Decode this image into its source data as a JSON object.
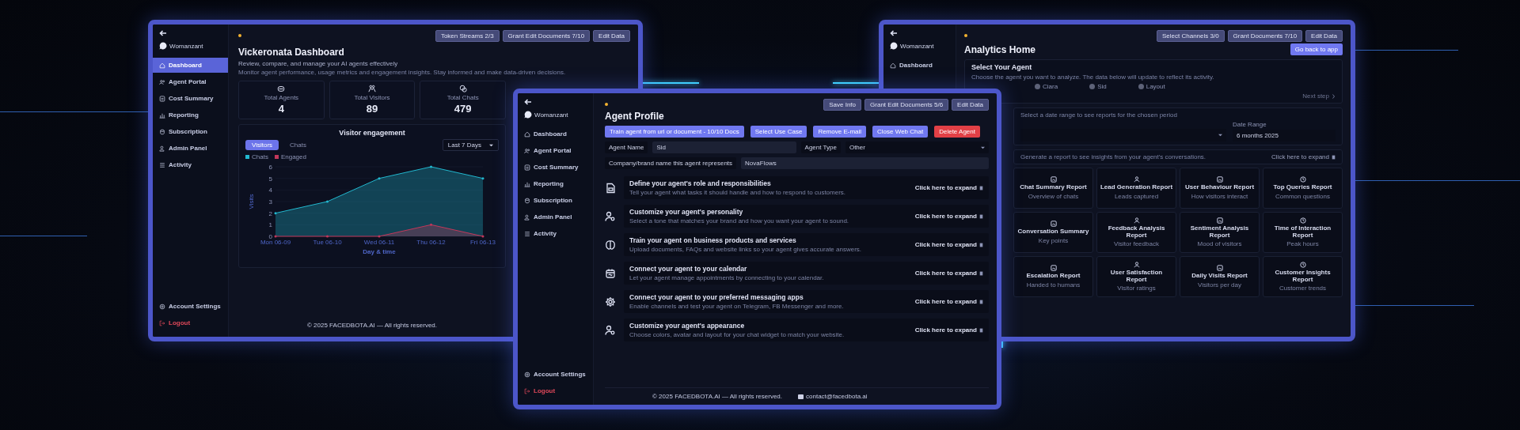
{
  "left_window": {
    "brand": "Womanzant",
    "nav": [
      {
        "label": "Dashboard",
        "selected": true
      },
      {
        "label": "Agent Portal",
        "selected": false
      },
      {
        "label": "Cost Summary",
        "selected": false
      },
      {
        "label": "Reporting",
        "selected": false
      },
      {
        "label": "Subscription",
        "selected": false
      },
      {
        "label": "Admin Panel",
        "selected": false
      },
      {
        "label": "Activity",
        "selected": false
      }
    ],
    "footer_nav": [
      {
        "label": "Account Settings",
        "kind": "normal"
      },
      {
        "label": "Logout",
        "kind": "danger"
      }
    ],
    "header_buttons": [
      "Token Streams 2/3",
      "Grant Edit Documents 7/10",
      "Edit Data"
    ],
    "title": "Vickeronata Dashboard",
    "subtitle": "Review, compare, and manage your AI agents effectively",
    "intro": "Monitor agent performance, usage metrics and engagement insights. Stay informed and make data-driven decisions.",
    "stats": [
      {
        "label": "Total Agents",
        "value": "4"
      },
      {
        "label": "Total Visitors",
        "value": "89"
      },
      {
        "label": "Total Chats",
        "value": "479"
      }
    ],
    "chart": {
      "tabs": [
        {
          "label": "Visitors",
          "selected": true
        },
        {
          "label": "Chats",
          "selected": false
        }
      ],
      "range": "Last 7 Days",
      "chart_data": {
        "type": "area",
        "title": "Visitor engagement",
        "xlabel": "Day & time",
        "ylabel": "Visits",
        "categories": [
          "Mon 06-09",
          "Tue 06-10",
          "Wed 06-11",
          "Thu 06-12",
          "Fri 06-13"
        ],
        "series": [
          {
            "name": "Chats",
            "color": "#22b8cf",
            "values": [
              2,
              3,
              5,
              6,
              5
            ]
          },
          {
            "name": "Engaged",
            "color": "#c2375a",
            "values": [
              0,
              0,
              0,
              1,
              0
            ]
          }
        ],
        "ylim": [
          0,
          6
        ],
        "yticks": [
          0,
          1,
          2,
          3,
          4,
          5,
          6
        ]
      }
    },
    "footer": "© 2025 FACEDBOTA.AI — All rights reserved."
  },
  "middle_window": {
    "brand": "Womanzant",
    "nav": [
      {
        "label": "Dashboard",
        "selected": false
      },
      {
        "label": "Agent Portal",
        "selected": false
      },
      {
        "label": "Cost Summary",
        "selected": false
      },
      {
        "label": "Reporting",
        "selected": false
      },
      {
        "label": "Subscription",
        "selected": false
      },
      {
        "label": "Admin Panel",
        "selected": false
      },
      {
        "label": "Activity",
        "selected": false
      }
    ],
    "footer_nav": [
      {
        "label": "Account Settings",
        "kind": "normal"
      },
      {
        "label": "Logout",
        "kind": "danger"
      }
    ],
    "header_buttons": [
      "Save Info",
      "Grant Edit Documents 5/6",
      "Edit Data"
    ],
    "title": "Agent Profile",
    "actions": [
      {
        "label": "Train agent from url or document - 10/10 Docs",
        "kind": "primary"
      },
      {
        "label": "Select Use Case",
        "kind": "primary"
      },
      {
        "label": "Remove E-mail",
        "kind": "primary"
      },
      {
        "label": "Close Web Chat",
        "kind": "primary"
      },
      {
        "label": "Delete Agent",
        "kind": "danger"
      }
    ],
    "fields": [
      {
        "label": "Agent Name",
        "value": "Sid",
        "kind": "text"
      },
      {
        "label": "Agent Type",
        "value": "Other",
        "kind": "select"
      },
      {
        "label": "Company/brand name this agent represents",
        "value": "NovaFlows",
        "kind": "text"
      }
    ],
    "tasks": [
      {
        "title": "Define your agent's role and responsibilities",
        "description": "Tell your agent what tasks it should handle and how to respond to customers.",
        "action": "Click here to expand"
      },
      {
        "title": "Customize your agent's personality",
        "description": "Select a tone that matches your brand and how you want your agent to sound.",
        "action": "Click here to expand"
      },
      {
        "title": "Train your agent on business products and services",
        "description": "Upload documents, FAQs and website links so your agent gives accurate answers.",
        "action": "Click here to expand"
      },
      {
        "title": "Connect your agent to your calendar",
        "description": "Let your agent manage appointments by connecting to your calendar.",
        "action": "Click here to expand"
      },
      {
        "title": "Connect your agent to your preferred messaging apps",
        "description": "Enable channels and test your agent on Telegram, FB Messenger and more.",
        "action": "Click here to expand"
      },
      {
        "title": "Customize your agent's appearance",
        "description": "Choose colors, avatar and layout for your chat widget to match your website.",
        "action": "Click here to expand"
      }
    ],
    "footer": "© 2025 FACEDBOTA.AI — All rights reserved.",
    "email": "contact@facedbota.ai"
  },
  "right_window": {
    "brand": "Womanzant",
    "nav": [
      {
        "label": "Dashboard",
        "selected": false
      }
    ],
    "header_buttons": [
      "Select Channels 3/0",
      "Grant Documents 7/10",
      "Edit Data"
    ],
    "back_button": "Go back to app",
    "title": "Analytics Home",
    "agent_card": {
      "title": "Select Your Agent",
      "description": "Choose the agent you want to analyze. The data below will update to reflect its activity.",
      "options": [
        {
          "label": "Ciara",
          "selected": false
        },
        {
          "label": "Sid",
          "selected": false
        },
        {
          "label": "Layout",
          "selected": false
        }
      ],
      "next": "Next step"
    },
    "filter": {
      "text": "Select a date range to see reports for the chosen period",
      "date_label": "Date Range",
      "date_value": "6 months 2025"
    },
    "report_bar": {
      "text": "Generate a report to see insights from your agent's conversations.",
      "action": "Click here to expand"
    },
    "reports": [
      {
        "title": "Chat Summary Report",
        "description": "Overview of chats"
      },
      {
        "title": "Lead Generation Report",
        "description": "Leads captured"
      },
      {
        "title": "User Behaviour Report",
        "description": "How visitors interact"
      },
      {
        "title": "Top Queries Report",
        "description": "Common questions"
      },
      {
        "title": "Conversation Summary",
        "description": "Key points"
      },
      {
        "title": "Feedback Analysis Report",
        "description": "Visitor feedback"
      },
      {
        "title": "Sentiment Analysis Report",
        "description": "Mood of visitors"
      },
      {
        "title": "Time of Interaction Report",
        "description": "Peak hours"
      },
      {
        "title": "Escalation Report",
        "description": "Handed to humans"
      },
      {
        "title": "User Satisfaction Report",
        "description": "Visitor ratings"
      },
      {
        "title": "Daily Visits Report",
        "description": "Visitors per day"
      },
      {
        "title": "Customer Insights Report",
        "description": "Customer trends"
      }
    ]
  }
}
